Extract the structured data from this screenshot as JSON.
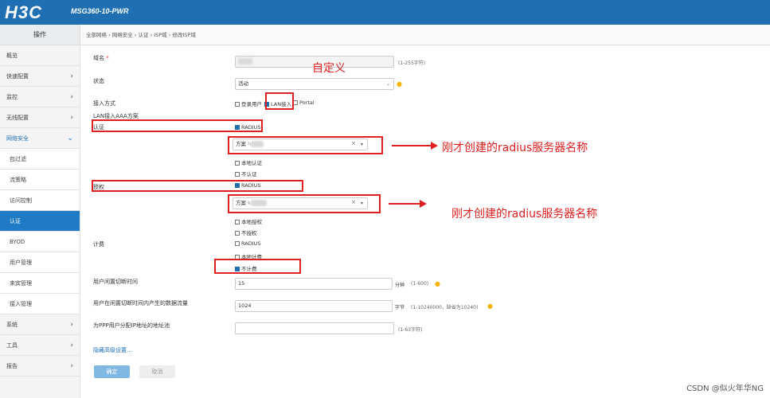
{
  "header": {
    "logo": "H3C",
    "model": "MSG360-10-PWR"
  },
  "sidebar": {
    "title": "操作",
    "items": [
      {
        "label": "概览",
        "chevron": ""
      },
      {
        "label": "快速配置",
        "chevron": "›"
      },
      {
        "label": "监控",
        "chevron": "›"
      },
      {
        "label": "无线配置",
        "chevron": "›"
      },
      {
        "label": "网络安全",
        "chevron": "⌄"
      },
      {
        "label": "包过滤"
      },
      {
        "label": "流策略"
      },
      {
        "label": "访问控制"
      },
      {
        "label": "认证"
      },
      {
        "label": "BYOD"
      },
      {
        "label": "用户管理"
      },
      {
        "label": "来宾管理"
      },
      {
        "label": "接入管理"
      },
      {
        "label": "系统",
        "chevron": "›"
      },
      {
        "label": "工具",
        "chevron": "›"
      },
      {
        "label": "报告",
        "chevron": "›"
      }
    ]
  },
  "breadcrumb": "全部网络 › 网络安全 › 认证 › ISP域 › 修改ISP域",
  "form": {
    "domain_label": "域名",
    "required_mark": "*",
    "domain_hint": "(1-255字符)",
    "status_label": "状态",
    "status_value": "活动",
    "access_label": "接入方式",
    "access_login": "登录用户",
    "access_lan": "LAN接入",
    "access_portal": "Portal",
    "aaa_title": "LAN接入AAA方案",
    "auth_label": "认证",
    "radius": "RADIUS",
    "scheme_label": "方案",
    "scheme_value": "h",
    "clear": "×",
    "dropdown": "▾",
    "auth_local": "本地认证",
    "auth_none": "不认证",
    "authz_label": "授权",
    "scheme2_value": "k",
    "authz_local": "本地授权",
    "authz_none": "不授权",
    "acct_label": "计费",
    "acct_radius": "RADIUS",
    "acct_local": "本地计费",
    "acct_none": "不计费",
    "idle_label": "用户闲置切断时间",
    "idle_value": "15",
    "idle_unit": "分钟",
    "idle_hint": "(1-600)",
    "traffic_label": "用户在闲置切断时间内产生的数据流量",
    "traffic_value": "1024",
    "traffic_unit": "字节",
    "traffic_hint": "(1-10240000，缺省为10240)",
    "ppp_label": "为PPP用户分配IP地址的地址池",
    "ppp_hint": "(1-63字符)",
    "advanced_link": "隐藏高级设置...",
    "ok_button": "确定",
    "cancel_button": "取消"
  },
  "annotations": {
    "custom": "自定义",
    "radius_name_1": "刚才创建的radius服务器名称",
    "radius_name_2": "刚才创建的radius服务器名称"
  },
  "watermark": "CSDN @似火年华NG",
  "colors": {
    "header": "#1f6fb2",
    "active": "#1f7bc6",
    "annotation": "#e02020"
  },
  "icons": [
    "lightbulb-icon",
    "chevron-right-icon",
    "chevron-down-icon",
    "clear-icon",
    "dropdown-arrow-icon",
    "checkbox-icon"
  ]
}
